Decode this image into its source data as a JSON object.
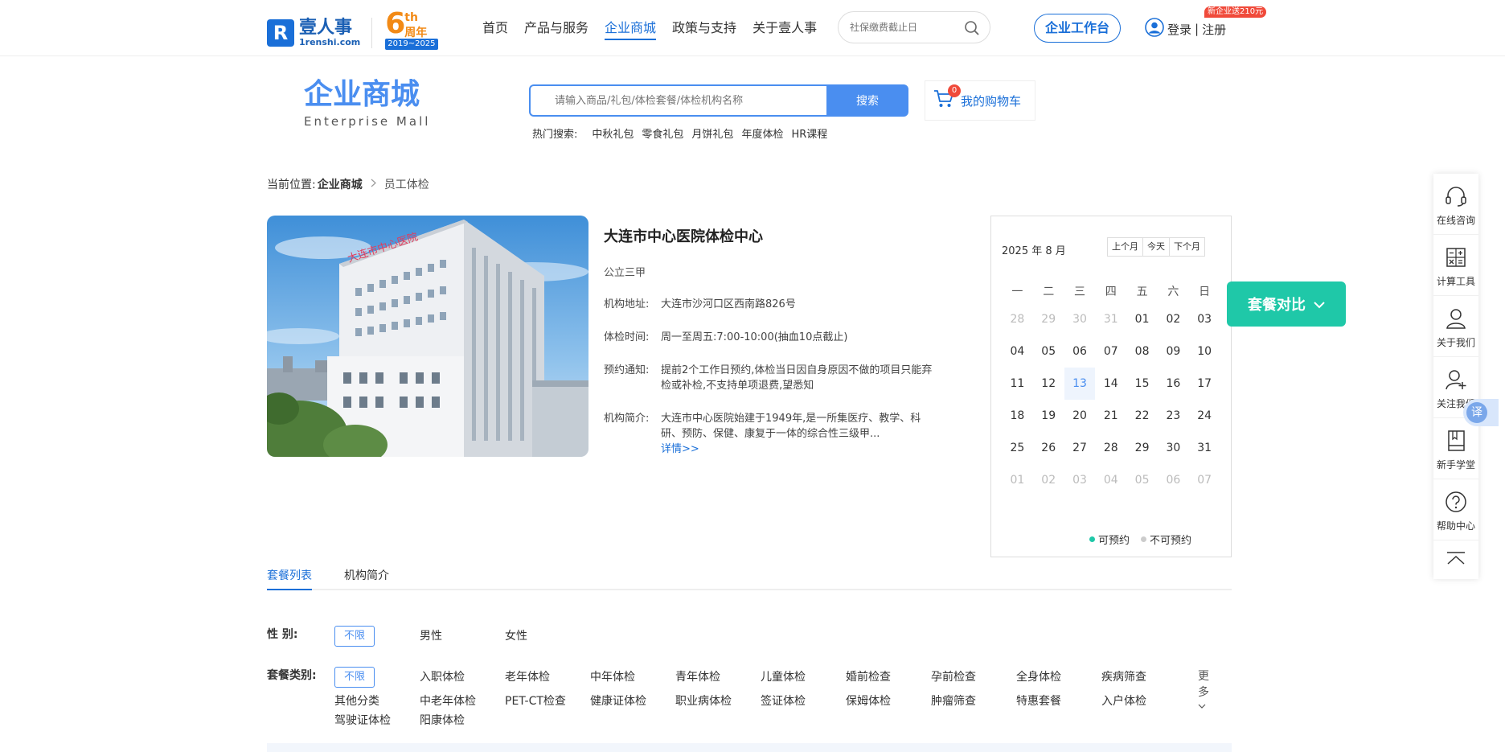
{
  "header": {
    "logo_cn": "壹人事",
    "logo_en": "1renshi.com",
    "anniv_num": "6",
    "anniv_th": "th",
    "anniv_zn": "周年",
    "anniv_years": "2019~2025",
    "nav": [
      "首页",
      "产品与服务",
      "企业商城",
      "政策与支持",
      "关于壹人事"
    ],
    "nav_active": 2,
    "search_placeholder": "社保缴费截止日",
    "workbench": "企业工作台",
    "login": "登录",
    "register": "注册",
    "divider": "|",
    "promo_badge": "新企业送210元"
  },
  "mall": {
    "title_cn": "企业商城",
    "title_en": "Enterprise Mall",
    "search_placeholder": "请输入商品/礼包/体检套餐/体检机构名称",
    "search_button": "搜索",
    "hot_label": "热门搜索:",
    "hot_keywords": [
      "中秋礼包",
      "零食礼包",
      "月饼礼包",
      "年度体检",
      "HR课程"
    ],
    "cart_count": "0",
    "cart_label": "我的购物车"
  },
  "breadcrumb": {
    "prefix": "当前位置:",
    "parent": "企业商城",
    "current": "员工体检"
  },
  "institution": {
    "photo_sign": "大连市中心医院",
    "name": "大连市中心医院体检中心",
    "level": "公立三甲",
    "address_label": "机构地址:",
    "address": "大连市沙河口区西南路826号",
    "hours_label": "体检时间:",
    "hours": "周一至周五:7:00-10:00(抽血10点截止)",
    "notice_label": "预约通知:",
    "notice": "提前2个工作日预约,体检当日因自身原因不做的项目只能弃检或补检,不支持单项退费,望悉知",
    "intro_label": "机构简介:",
    "intro": " 大连市中心医院始建于1949年,是一所集医疗、教学、科研、预防、保健、康复于一体的综合性三级甲...",
    "more": "详情>>"
  },
  "calendar": {
    "month_label": "2025 年 8 月",
    "prev": "上个月",
    "today": "今天",
    "next": "下个月",
    "weekdays": [
      "一",
      "二",
      "三",
      "四",
      "五",
      "六",
      "日"
    ],
    "weeks": [
      [
        "28",
        "29",
        "30",
        "31",
        "01",
        "02",
        "03"
      ],
      [
        "04",
        "05",
        "06",
        "07",
        "08",
        "09",
        "10"
      ],
      [
        "11",
        "12",
        "13",
        "14",
        "15",
        "16",
        "17"
      ],
      [
        "18",
        "19",
        "20",
        "21",
        "22",
        "23",
        "24"
      ],
      [
        "25",
        "26",
        "27",
        "28",
        "29",
        "30",
        "31"
      ],
      [
        "01",
        "02",
        "03",
        "04",
        "05",
        "06",
        "07"
      ]
    ],
    "today_date": "13",
    "legend_available": "可预约",
    "legend_unavailable": "不可预约",
    "color_available": "#1fc8a8",
    "color_unavailable": "#cccccc"
  },
  "compare": {
    "label": "套餐对比"
  },
  "sidebar": {
    "items": [
      {
        "label": "在线咨询",
        "icon": "headset-icon"
      },
      {
        "label": "计算工具",
        "icon": "calculator-icon"
      },
      {
        "label": "关于我们",
        "icon": "user-icon"
      },
      {
        "label": "关注我们",
        "icon": "add-user-icon"
      },
      {
        "label": "新手学堂",
        "icon": "book-icon"
      },
      {
        "label": "帮助中心",
        "icon": "help-icon"
      }
    ],
    "translate": "译"
  },
  "tabs": [
    "套餐列表",
    "机构简介"
  ],
  "filters": {
    "gender": {
      "label": "性    别:",
      "all": "不限",
      "options": [
        "男性",
        "女性"
      ]
    },
    "category": {
      "label": "套餐类别:",
      "all": "不限",
      "row1": [
        "入职体检",
        "老年体检",
        "中年体检",
        "青年体检",
        "儿童体检",
        "婚前检查",
        "孕前检查",
        "全身体检",
        "疾病筛查"
      ],
      "row2": [
        "其他分类",
        "中老年体检",
        "PET-CT检查",
        "健康证体检",
        "职业病体检",
        "签证体检",
        "保姆体检",
        "肿瘤筛查",
        "特惠套餐",
        "入户体检"
      ],
      "row3": [
        "驾驶证体检",
        "阳康体检"
      ],
      "more": "更多"
    }
  },
  "colors": {
    "brand": "#1a6fd8",
    "accent": "#4a8ef0",
    "compare": "#1fc8a8",
    "badge": "#f04a3a"
  }
}
